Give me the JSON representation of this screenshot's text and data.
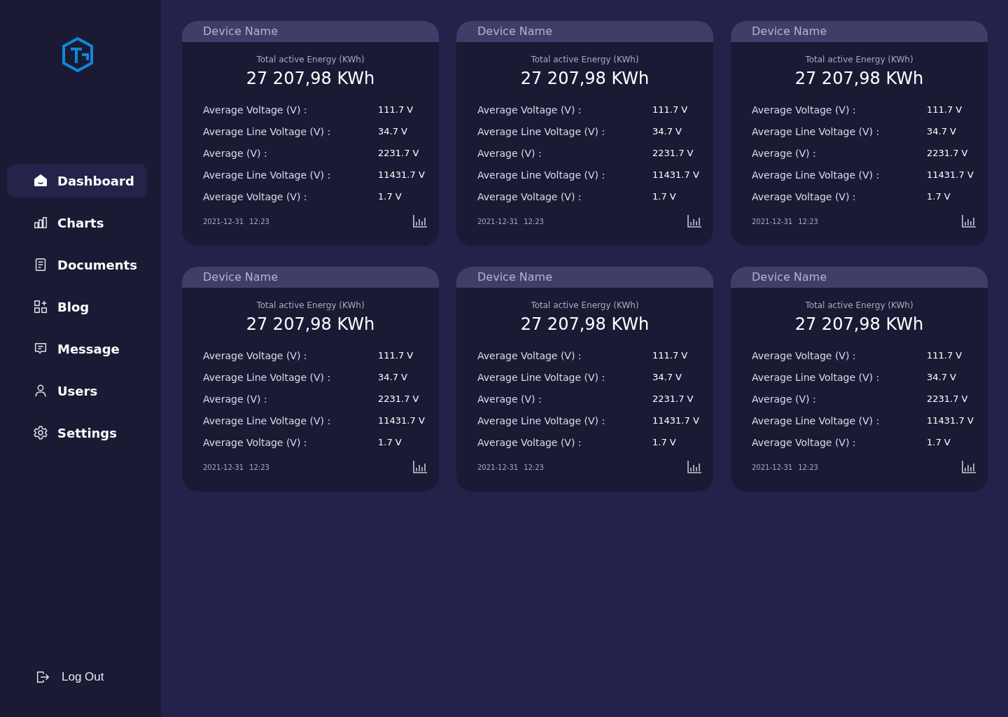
{
  "nav": [
    {
      "kind": "dashboard",
      "label": "Dashboard",
      "selected": true
    },
    {
      "kind": "charts",
      "label": "Charts",
      "selected": false
    },
    {
      "kind": "documents",
      "label": "Documents",
      "selected": false
    },
    {
      "kind": "blog",
      "label": "Blog",
      "selected": false
    },
    {
      "kind": "message",
      "label": "Message",
      "selected": false
    },
    {
      "kind": "users",
      "label": "Users",
      "selected": false
    },
    {
      "kind": "settings",
      "label": "Settings",
      "selected": false
    }
  ],
  "logout": "Log Out",
  "cards": [
    {
      "device_name": "Device Name",
      "energy_label": "Total active Energy (KWh)",
      "energy_value": "27 207,98 KWh",
      "rows": [
        {
          "label": "Average Voltage (V) :",
          "value": "111.7 V"
        },
        {
          "label": "Average Line Voltage (V) :",
          "value": "34.7 V"
        },
        {
          "label": "Average  (V) :",
          "value": "2231.7 V"
        },
        {
          "label": "Average Line Voltage (V) :",
          "value": "11431.7 V"
        },
        {
          "label": "Average Voltage (V) :",
          "value": "1.7 V"
        }
      ],
      "date": "2021-12-31",
      "time": "12:23"
    },
    {
      "device_name": "Device Name",
      "energy_label": "Total active Energy (KWh)",
      "energy_value": "27 207,98 KWh",
      "rows": [
        {
          "label": "Average Voltage (V) :",
          "value": "111.7 V"
        },
        {
          "label": "Average Line Voltage (V) :",
          "value": "34.7 V"
        },
        {
          "label": "Average  (V) :",
          "value": "2231.7 V"
        },
        {
          "label": "Average Line Voltage (V) :",
          "value": "11431.7 V"
        },
        {
          "label": "Average Voltage (V) :",
          "value": "1.7 V"
        }
      ],
      "date": "2021-12-31",
      "time": "12:23"
    },
    {
      "device_name": "Device Name",
      "energy_label": "Total active Energy (KWh)",
      "energy_value": "27 207,98 KWh",
      "rows": [
        {
          "label": "Average Voltage (V) :",
          "value": "111.7 V"
        },
        {
          "label": "Average Line Voltage (V) :",
          "value": "34.7 V"
        },
        {
          "label": "Average  (V) :",
          "value": "2231.7 V"
        },
        {
          "label": "Average Line Voltage (V) :",
          "value": "11431.7 V"
        },
        {
          "label": "Average Voltage (V) :",
          "value": "1.7 V"
        }
      ],
      "date": "2021-12-31",
      "time": "12:23"
    },
    {
      "device_name": "Device Name",
      "energy_label": "Total active Energy (KWh)",
      "energy_value": "27 207,98 KWh",
      "rows": [
        {
          "label": "Average Voltage (V) :",
          "value": "111.7 V"
        },
        {
          "label": "Average Line Voltage (V) :",
          "value": "34.7 V"
        },
        {
          "label": "Average  (V) :",
          "value": "2231.7 V"
        },
        {
          "label": "Average Line Voltage (V) :",
          "value": "11431.7 V"
        },
        {
          "label": "Average Voltage (V) :",
          "value": "1.7 V"
        }
      ],
      "date": "2021-12-31",
      "time": "12:23"
    },
    {
      "device_name": "Device Name",
      "energy_label": "Total active Energy (KWh)",
      "energy_value": "27 207,98 KWh",
      "rows": [
        {
          "label": "Average Voltage (V) :",
          "value": "111.7 V"
        },
        {
          "label": "Average Line Voltage (V) :",
          "value": "34.7 V"
        },
        {
          "label": "Average  (V) :",
          "value": "2231.7 V"
        },
        {
          "label": "Average Line Voltage (V) :",
          "value": "11431.7 V"
        },
        {
          "label": "Average Voltage (V) :",
          "value": "1.7 V"
        }
      ],
      "date": "2021-12-31",
      "time": "12:23"
    },
    {
      "device_name": "Device Name",
      "energy_label": "Total active Energy (KWh)",
      "energy_value": "27 207,98 KWh",
      "rows": [
        {
          "label": "Average Voltage (V) :",
          "value": "111.7 V"
        },
        {
          "label": "Average Line Voltage (V) :",
          "value": "34.7 V"
        },
        {
          "label": "Average  (V) :",
          "value": "2231.7 V"
        },
        {
          "label": "Average Line Voltage (V) :",
          "value": "11431.7 V"
        },
        {
          "label": "Average Voltage (V) :",
          "value": "1.7 V"
        }
      ],
      "date": "2021-12-31",
      "time": "12:23"
    }
  ]
}
